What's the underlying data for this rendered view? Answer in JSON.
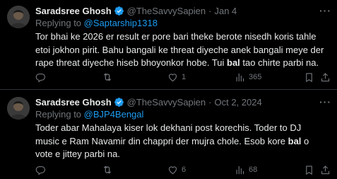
{
  "tweets": [
    {
      "display_name": "Saradsree Ghosh",
      "handle": "@TheSavvySapien",
      "separator": "·",
      "timestamp": "Jan 4",
      "replying_prefix": "Replying to ",
      "replying_to": "@Saptarship1318",
      "text_before": "Tor bhai ke 2026 er result er pore bari theke berote nisedh koris tahle etoi jokhon pirit. Bahu bangali ke threat diyeche anek bangali meye der rape threat diyeche hiseb bhoyonkor hobe. Tui ",
      "text_bold": "bal",
      "text_after": " tao chirte parbi na.",
      "replies": "",
      "retweets": "",
      "likes": "1",
      "views": "365"
    },
    {
      "display_name": "Saradsree Ghosh",
      "handle": "@TheSavvySapien",
      "separator": "·",
      "timestamp": "Oct 2, 2024",
      "replying_prefix": "Replying to ",
      "replying_to": "@BJP4Bengal",
      "text_before": "Toder abar Mahalaya kiser lok dekhani post korechis. Toder to DJ music e Ram Navamir din chappri der mujra chole. Esob kore ",
      "text_bold": "bal",
      "text_after": " o vote e jittey parbi na.",
      "replies": "",
      "retweets": "",
      "likes": "6",
      "views": "68"
    }
  ],
  "icons": {
    "more": "more-horizontal-icon",
    "verified": "verified-badge-icon",
    "reply": "reply-icon",
    "retweet": "retweet-icon",
    "like": "heart-icon",
    "views": "views-icon",
    "bookmark": "bookmark-icon",
    "share": "share-icon"
  },
  "colors": {
    "background": "#000000",
    "text": "#e7e9ea",
    "muted": "#71767b",
    "accent": "#1d9bf0",
    "divider": "#2f3336"
  }
}
